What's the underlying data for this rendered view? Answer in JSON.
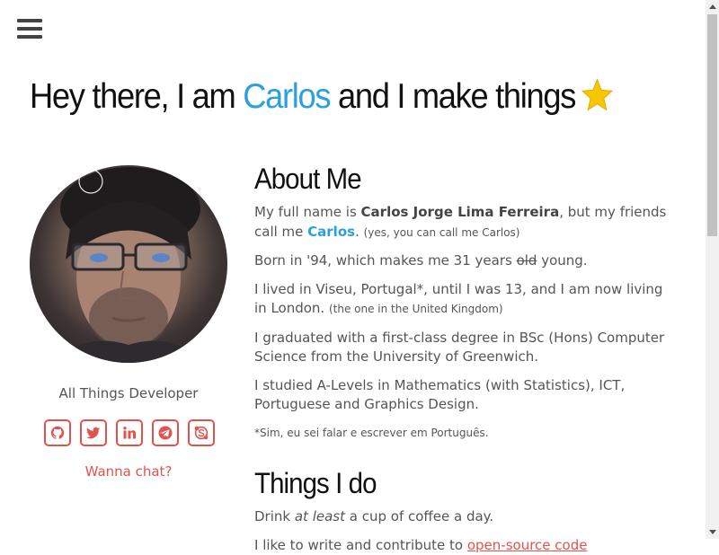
{
  "header": {
    "menu_icon": "hamburger-menu-icon",
    "hero_prefix": "Hey there, I am ",
    "hero_name": "Carlos",
    "hero_suffix": " and I make things",
    "hero_icon": "star-icon",
    "accent_color": "#2b9fe0",
    "star_color": "#f7c600"
  },
  "sidebar": {
    "role": "All Things Developer",
    "social_icons": [
      "github-icon",
      "twitter-icon",
      "linkedin-icon",
      "telegram-icon",
      "skype-icon"
    ],
    "chat_label": "Wanna chat?",
    "link_color": "#e0544c"
  },
  "about": {
    "heading": "About Me",
    "p1_a": "My full name is ",
    "p1_fullname": "Carlos Jorge Lima Ferreira",
    "p1_b": ", but my friends call me ",
    "p1_nick": "Carlos",
    "p1_c": ". ",
    "p1_note": "(yes, you can call me Carlos)",
    "p2_a": "Born in '94, which makes me 31 years ",
    "p2_strike": "old",
    "p2_b": " young.",
    "p3_a": "I lived in Viseu, Portugal*, until I was 13, and I am now living in London. ",
    "p3_note": "(the one in the United Kingdom)",
    "p4": "I graduated with a first-class degree in BSc (Hons) Computer Science from the University of Greenwich.",
    "p5": "I studied A-Levels in Mathematics (with Statistics), ICT, Portuguese and Graphics Design.",
    "footnote": "*Sim, eu sei falar e escrever em Português."
  },
  "things": {
    "heading": "Things I do",
    "p1_a": "Drink ",
    "p1_em": "at least",
    "p1_b": " a cup of coffee a day.",
    "p2_a": "I like to write and contribute to ",
    "p2_link": "open-source code"
  }
}
